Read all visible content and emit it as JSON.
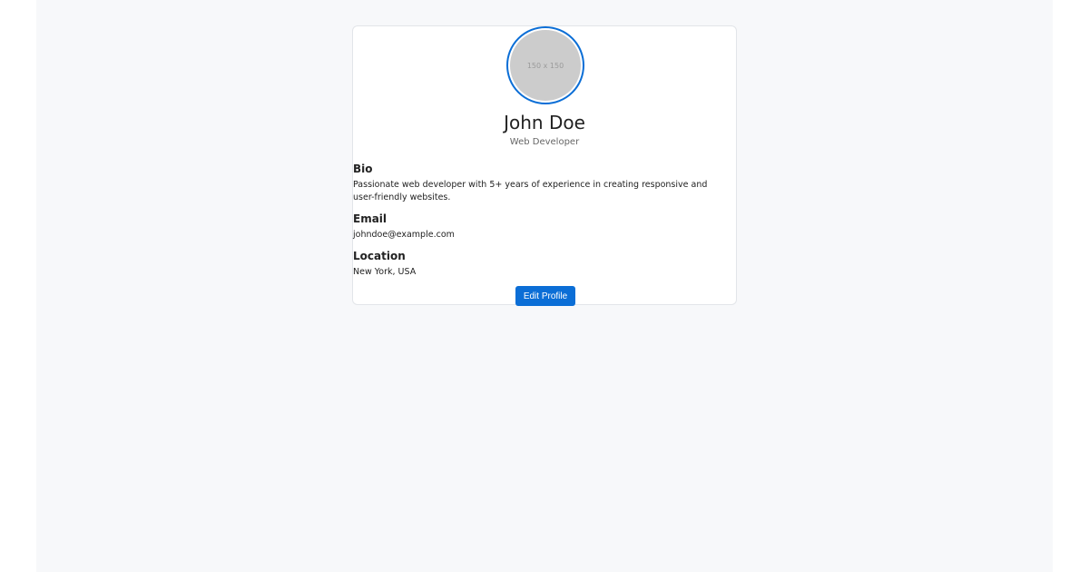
{
  "profile": {
    "avatar_placeholder": "150 x 150",
    "name": "John Doe",
    "role": "Web Developer"
  },
  "sections": {
    "bio": {
      "title": "Bio",
      "text": "Passionate web developer with 5+ years of experience in creating responsive and user-friendly websites."
    },
    "email": {
      "title": "Email",
      "text": "johndoe@example.com"
    },
    "location": {
      "title": "Location",
      "text": "New York, USA"
    }
  },
  "actions": {
    "edit_label": "Edit Profile"
  },
  "colors": {
    "accent": "#0b6ed6",
    "background": "#f7f8fa",
    "card": "#ffffff",
    "avatar_placeholder": "#cccccc"
  }
}
